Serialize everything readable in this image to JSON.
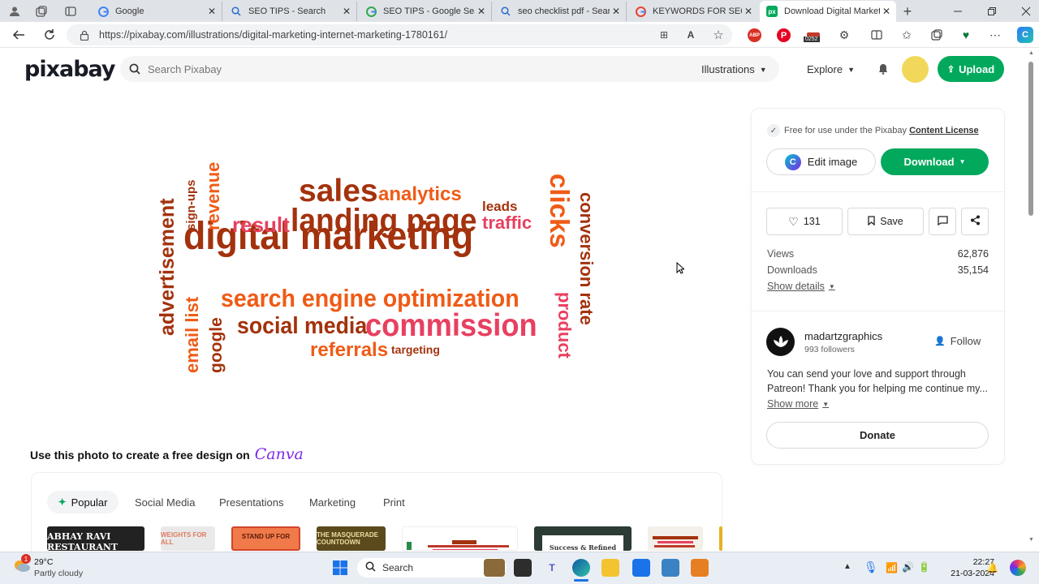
{
  "browser": {
    "tabs": [
      {
        "title": "Google",
        "icon": "google-icon"
      },
      {
        "title": "SEO TIPS - Search",
        "icon": "search-icon"
      },
      {
        "title": "SEO TIPS - Google Search",
        "icon": "google-icon"
      },
      {
        "title": "seo checklist pdf - Search",
        "icon": "search-icon"
      },
      {
        "title": "KEYWORDS FOR SEO PDF",
        "icon": "google-icon"
      },
      {
        "title": "Download Digital Marketing",
        "icon": "pixabay-icon"
      }
    ],
    "url": "https://pixabay.com/illustrations/digital-marketing-internet-marketing-1780161/",
    "ext_badge": "0252"
  },
  "site": {
    "logo": "pixabay",
    "search_placeholder": "Search Pixabay",
    "search_type": "Illustrations",
    "explore": "Explore",
    "upload": "Upload"
  },
  "panel": {
    "license_text": "Free for use under the Pixabay",
    "license_link": "Content License",
    "edit_image": "Edit image",
    "download": "Download",
    "likes": "131",
    "save": "Save",
    "views_label": "Views",
    "views": "62,876",
    "downloads_label": "Downloads",
    "downloads": "35,154",
    "show_details": "Show details",
    "author": "madartzgraphics",
    "followers": "993 followers",
    "follow": "Follow",
    "bio": "You can send your love and support through Patreon! Thank you for helping me continue my...",
    "show_more": "Show more",
    "donate": "Donate"
  },
  "wordcloud": {
    "words": [
      "digital marketing",
      "search engine optimization",
      "commission",
      "social media",
      "landing page",
      "sales",
      "analytics",
      "result",
      "leads",
      "traffic",
      "clicks",
      "conversion rate",
      "product",
      "referrals",
      "targeting",
      "advertisement",
      "email list",
      "google",
      "sign-ups",
      "revenue"
    ]
  },
  "canva": {
    "heading": "Use this photo to create a free design on",
    "brand": "Canva",
    "tabs": [
      "Popular",
      "Social Media",
      "Presentations",
      "Marketing",
      "Print"
    ],
    "thumbs": [
      {
        "text": "ABHAY RAVI RESTAURANT",
        "bg": "#222"
      },
      {
        "text": "WEIGHTS FOR ALL",
        "bg": "#e9e9e9"
      },
      {
        "text": "STAND UP FOR",
        "bg": "#f07a4a"
      },
      {
        "text": "THE MASQUERADE COUNTDOWN",
        "bg": "#5a4a1c"
      },
      {
        "text": "",
        "bg": "#ffffff"
      },
      {
        "text": "Success & Refined",
        "bg": "#2c3b34"
      },
      {
        "text": "",
        "bg": "#f3efe9"
      }
    ]
  },
  "taskbar": {
    "temp": "29°C",
    "weather": "Partly cloudy",
    "weather_badge": "1",
    "search": "Search",
    "time": "22:27",
    "date": "21-03-2024"
  },
  "colors": {
    "brand_green": "#02a95c",
    "cloud_dark": "#a3320d",
    "cloud_orange": "#ef5b16",
    "cloud_pink": "#e84060"
  }
}
